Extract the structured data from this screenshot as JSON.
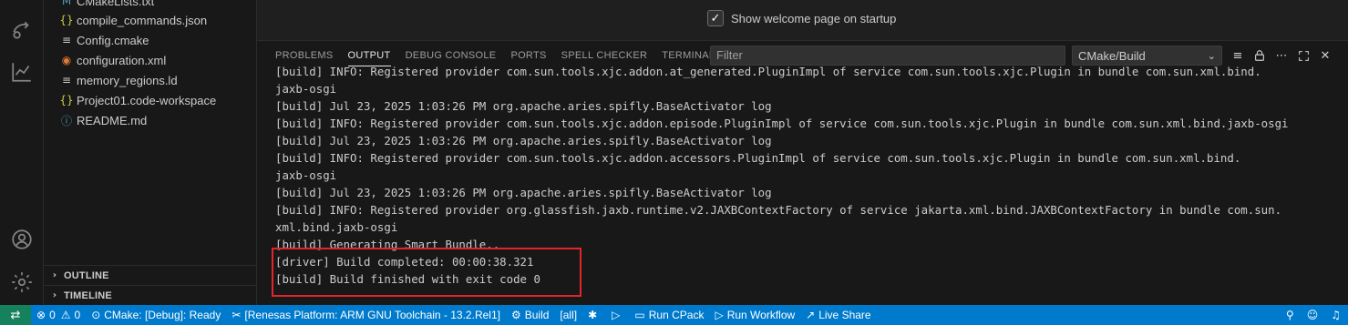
{
  "sidebar": {
    "files": [
      {
        "name": "CMakeLists.txt",
        "icon": "cmake-icon",
        "glyph": "M",
        "color": "#519aba"
      },
      {
        "name": "compile_commands.json",
        "icon": "json-icon",
        "glyph": "{}",
        "color": "#cbcb41"
      },
      {
        "name": "Config.cmake",
        "icon": "list-icon",
        "glyph": "≡",
        "color": "#cccccc"
      },
      {
        "name": "configuration.xml",
        "icon": "rss-icon",
        "glyph": "◉",
        "color": "#e37933"
      },
      {
        "name": "memory_regions.ld",
        "icon": "list-icon",
        "glyph": "≡",
        "color": "#cccccc"
      },
      {
        "name": "Project01.code-workspace",
        "icon": "json-icon",
        "glyph": "{}",
        "color": "#cbcb41"
      },
      {
        "name": "README.md",
        "icon": "info-icon",
        "glyph": "ⓘ",
        "color": "#519aba"
      }
    ],
    "outline_label": "OUTLINE",
    "timeline_label": "TIMELINE"
  },
  "welcome": {
    "checkbox_label": "Show welcome page on startup",
    "checked": true
  },
  "panel": {
    "tabs": [
      {
        "label": "PROBLEMS",
        "active": false
      },
      {
        "label": "OUTPUT",
        "active": true
      },
      {
        "label": "DEBUG CONSOLE",
        "active": false
      },
      {
        "label": "PORTS",
        "active": false
      },
      {
        "label": "SPELL CHECKER",
        "active": false
      },
      {
        "label": "TERMINAL",
        "active": false
      }
    ],
    "filter_placeholder": "Filter",
    "channel": "CMake/Build",
    "output_lines": [
      "[build] INFO: Registered provider com.sun.tools.xjc.addon.at_generated.PluginImpl of service com.sun.tools.xjc.Plugin in bundle com.sun.xml.bind.",
      "jaxb-osgi",
      "[build] Jul 23, 2025 1:03:26 PM org.apache.aries.spifly.BaseActivator log",
      "[build] INFO: Registered provider com.sun.tools.xjc.addon.episode.PluginImpl of service com.sun.tools.xjc.Plugin in bundle com.sun.xml.bind.jaxb-osgi",
      "[build] Jul 23, 2025 1:03:26 PM org.apache.aries.spifly.BaseActivator log",
      "[build] INFO: Registered provider com.sun.tools.xjc.addon.accessors.PluginImpl of service com.sun.tools.xjc.Plugin in bundle com.sun.xml.bind.",
      "jaxb-osgi",
      "[build] Jul 23, 2025 1:03:26 PM org.apache.aries.spifly.BaseActivator log",
      "[build] INFO: Registered provider org.glassfish.jaxb.runtime.v2.JAXBContextFactory of service jakarta.xml.bind.JAXBContextFactory in bundle com.sun.",
      "xml.bind.jaxb-osgi",
      "[build] Generating Smart Bundle..",
      "[driver] Build completed: 00:00:38.321",
      "[build] Build finished with exit code 0"
    ]
  },
  "statusbar": {
    "errors": "0",
    "warnings": "0",
    "cmake_status": "CMake: [Debug]: Ready",
    "toolchain": "[Renesas Platform: ARM GNU Toolchain - 13.2.Rel1]",
    "build_label": "Build",
    "target": "[all]",
    "run_cpack": "Run CPack",
    "run_workflow": "Run Workflow",
    "live_share": "Live Share"
  },
  "colors": {
    "statusbar_bg": "#007acc",
    "remote_bg": "#16825d",
    "highlight": "#e3242b"
  }
}
